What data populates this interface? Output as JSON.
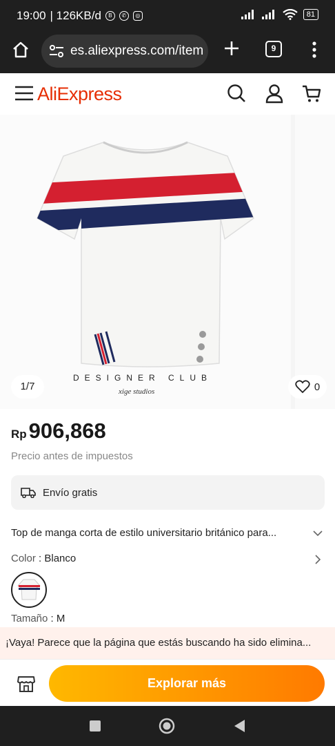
{
  "statusbar": {
    "time": "19:00",
    "speed": "| 126KB/d",
    "battery": "81"
  },
  "browser": {
    "url": "es.aliexpress.com/item",
    "tab_count": "9"
  },
  "header": {
    "logo": "AliExpress"
  },
  "gallery": {
    "pager": "1/7",
    "wish_count": "0",
    "brand": "DESIGNER CLUB",
    "brand_sub": "xige studios"
  },
  "product": {
    "currency": "Rp",
    "price": "906,868",
    "pretax_note": "Precio antes de impuestos",
    "shipping": "Envío gratis",
    "title": "Top de manga corta de estilo universitario británico para...",
    "color_label": "Color",
    "color_value": ": Blanco",
    "size_label": "Tamaño",
    "size_value": ": M"
  },
  "notice": "¡Vaya! Parece que la página que estás buscando ha sido elimina...",
  "actions": {
    "explore": "Explorar más"
  },
  "colors": {
    "brand": "#e62e04",
    "button_start": "#ffb800",
    "button_end": "#ff7a00"
  }
}
